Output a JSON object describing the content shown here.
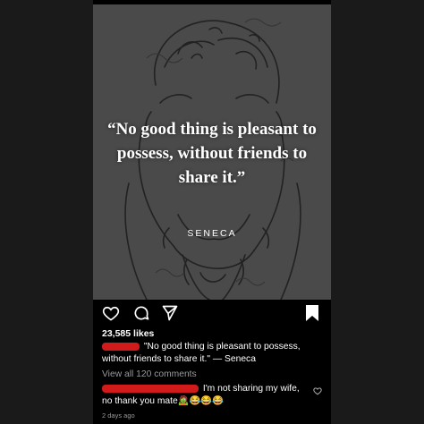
{
  "post": {
    "quote": "“No good thing is pleasant to possess, without friends to share it.”",
    "author": "SENECA"
  },
  "actions": {
    "like_icon": "heart-outline-icon",
    "comment_icon": "comment-bubble-icon",
    "share_icon": "paper-plane-icon",
    "save_icon": "bookmark-filled-icon"
  },
  "likes": "23,585 likes",
  "caption": {
    "text": " \"No good thing is pleasant to possess, without friends to share it.\" — Seneca"
  },
  "view_all": "View all 120 comments",
  "comment": {
    "text": " I'm not sharing my wife, no thank you mate🧟😂😂😂",
    "like_icon": "heart-outline-small-icon"
  },
  "date": "2 days ago",
  "colors": {
    "background": "#000000",
    "image_bg": "#4a4a4a",
    "redaction": "#d11a1a",
    "muted_text": "#9a9a9a"
  }
}
